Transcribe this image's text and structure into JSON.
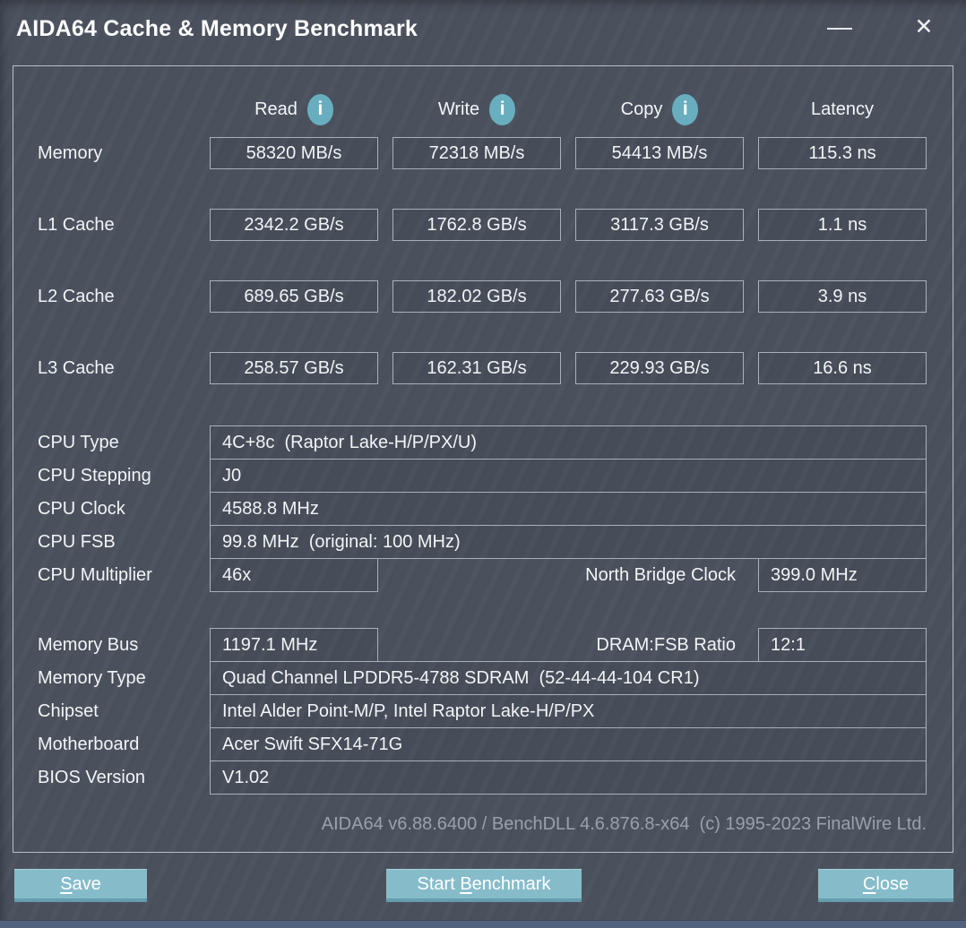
{
  "window": {
    "title": "AIDA64 Cache & Memory Benchmark"
  },
  "icons": {
    "minimize": "—",
    "close": "✕",
    "info": "i"
  },
  "benchmark": {
    "headers": [
      {
        "label": "Read",
        "has_info": true
      },
      {
        "label": "Write",
        "has_info": true
      },
      {
        "label": "Copy",
        "has_info": true
      },
      {
        "label": "Latency",
        "has_info": false
      }
    ],
    "rows": [
      {
        "label": "Memory",
        "values": [
          "58320 MB/s",
          "72318 MB/s",
          "54413 MB/s",
          "115.3 ns"
        ]
      },
      {
        "label": "L1 Cache",
        "values": [
          "2342.2 GB/s",
          "1762.8 GB/s",
          "3117.3 GB/s",
          "1.1 ns"
        ]
      },
      {
        "label": "L2 Cache",
        "values": [
          "689.65 GB/s",
          "182.02 GB/s",
          "277.63 GB/s",
          "3.9 ns"
        ]
      },
      {
        "label": "L3 Cache",
        "values": [
          "258.57 GB/s",
          "162.31 GB/s",
          "229.93 GB/s",
          "16.6 ns"
        ]
      }
    ]
  },
  "system_info": {
    "cpu": [
      {
        "label": "CPU Type",
        "value": "4C+8c  (Raptor Lake-H/P/PX/U)"
      },
      {
        "label": "CPU Stepping",
        "value": "J0"
      },
      {
        "label": "CPU Clock",
        "value": "4588.8 MHz"
      },
      {
        "label": "CPU FSB",
        "value": "99.8 MHz  (original: 100 MHz)"
      }
    ],
    "cpu_multiplier": {
      "label": "CPU Multiplier",
      "value": "46x"
    },
    "north_bridge": {
      "label": "North Bridge Clock",
      "value": "399.0 MHz"
    },
    "memory_bus": {
      "label": "Memory Bus",
      "value": "1197.1 MHz"
    },
    "dram_fsb": {
      "label": "DRAM:FSB Ratio",
      "value": "12:1"
    },
    "memory": [
      {
        "label": "Memory Type",
        "value": "Quad Channel LPDDR5-4788 SDRAM  (52-44-44-104 CR1)"
      },
      {
        "label": "Chipset",
        "value": "Intel Alder Point-M/P, Intel Raptor Lake-H/P/PX"
      },
      {
        "label": "Motherboard",
        "value": "Acer Swift SFX14-71G"
      },
      {
        "label": "BIOS Version",
        "value": "V1.02"
      }
    ]
  },
  "footer": {
    "credits": "AIDA64 v6.88.6400 / BenchDLL 4.6.876.8-x64  (c) 1995-2023 FinalWire Ltd."
  },
  "buttons": {
    "save": {
      "pre": "",
      "key": "S",
      "post": "ave"
    },
    "start_benchmark": {
      "pre": "Start ",
      "key": "B",
      "post": "enchmark"
    },
    "close": {
      "pre": "",
      "key": "C",
      "post": "lose"
    }
  },
  "colors": {
    "accent_teal": "#86bcca",
    "info_icon_teal": "#69aebf",
    "panel_border": "#b9bec5",
    "background": "#4a515d",
    "footer_text": "#9aa1ab",
    "bottom_strip": "#51627c"
  }
}
